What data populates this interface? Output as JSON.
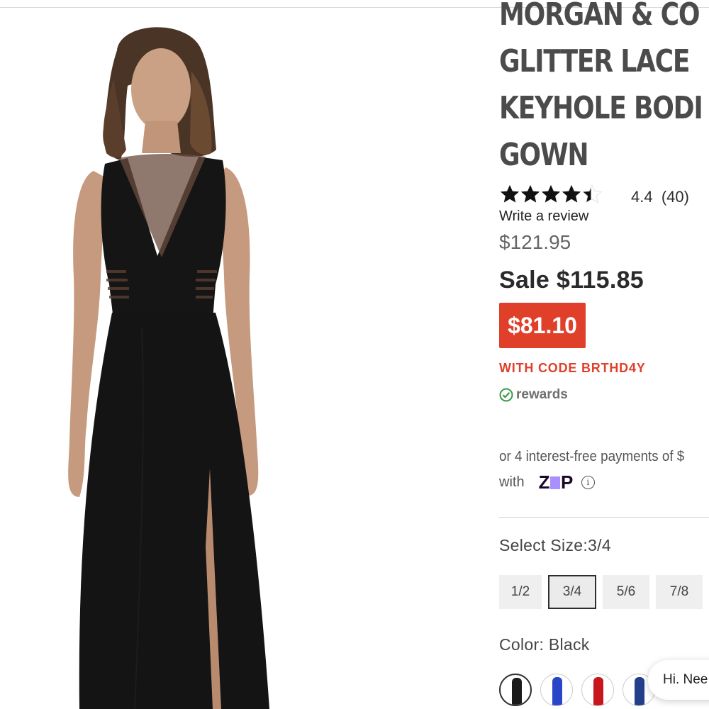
{
  "product": {
    "image_alt": "Model wearing a long black sleeveless gown with sheer illusion V-neck, striped sheer waist cutouts and a front leg slit",
    "title_lines": [
      "MORGAN & CO",
      "GLITTER LACE",
      "KEYHOLE BODI",
      "GOWN"
    ],
    "rating": {
      "stars_value": 4.4,
      "score": "4.4",
      "count": "(40)",
      "review_link": "Write a review"
    },
    "original_price": "$121.95",
    "sale_price": "Sale $115.85",
    "promo_price": "$81.10",
    "promo_code_text": "WITH CODE BRTHD4Y",
    "rewards_label": "rewards",
    "installments_text": "or 4 interest-free payments of $",
    "zip_with": "with",
    "zip_brand": "ZIP",
    "size_label": "Select Size:3/4",
    "sizes": [
      {
        "label": "1/2",
        "selected": false
      },
      {
        "label": "3/4",
        "selected": true
      },
      {
        "label": "5/6",
        "selected": false
      },
      {
        "label": "7/8",
        "selected": false
      },
      {
        "label": "",
        "selected": false
      }
    ],
    "color_label": "Color: Black",
    "swatches": [
      {
        "name": "Black",
        "color": "#1a1a1a",
        "selected": true
      },
      {
        "name": "Royal Blue",
        "color": "#2a46c8",
        "selected": false
      },
      {
        "name": "Red",
        "color": "#c8161e",
        "selected": false
      },
      {
        "name": "Navy",
        "color": "#233e8a",
        "selected": false
      }
    ]
  },
  "chat": {
    "text": "Hi. Nee"
  },
  "colors": {
    "promo": "#e0402a",
    "title": "#4b4b4b",
    "zip_purple": "#aa8fff"
  }
}
